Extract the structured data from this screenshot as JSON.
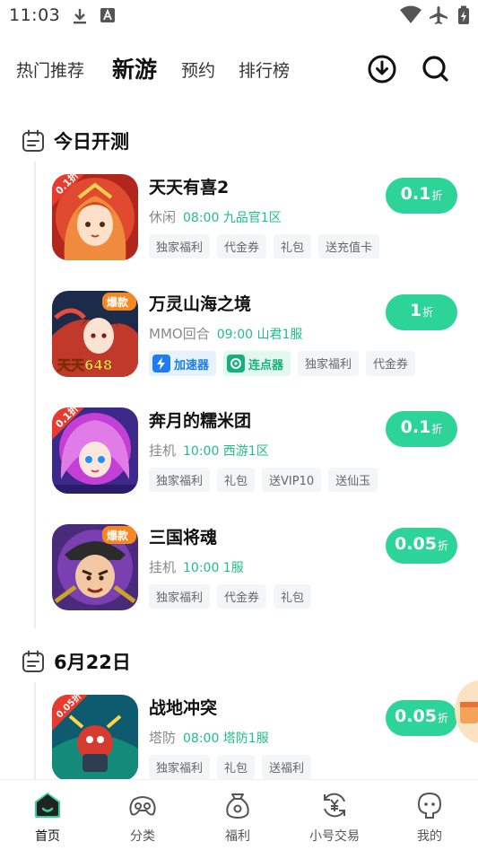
{
  "status_bar": {
    "time": "11:03"
  },
  "top_nav": {
    "tabs": [
      {
        "label": "热门推荐",
        "active": false
      },
      {
        "label": "新游",
        "active": true
      },
      {
        "label": "预约",
        "active": false
      },
      {
        "label": "排行榜",
        "active": false
      }
    ]
  },
  "sections": [
    {
      "title": "今日开测",
      "games": [
        {
          "name": "天天有喜2",
          "category": "休闲",
          "open_time": "08:00 九品官1区",
          "tags": [
            "独家福利",
            "代金券",
            "礼包",
            "送充值卡"
          ],
          "discount": "0.1",
          "discount_unit": "折",
          "badge": "0.1折"
        },
        {
          "name": "万灵山海之境",
          "category": "MMO回合",
          "open_time": "09:00 山君1服",
          "tags": [
            "加速器",
            "连点器",
            "独家福利",
            "代金券"
          ],
          "discount": "1",
          "discount_unit": "折",
          "badge": "爆款",
          "icon_text": "天天648"
        },
        {
          "name": "奔月的糯米团",
          "category": "挂机",
          "open_time": "10:00 西游1区",
          "tags": [
            "独家福利",
            "礼包",
            "送VIP10",
            "送仙玉"
          ],
          "discount": "0.1",
          "discount_unit": "折",
          "badge": "0.1折"
        },
        {
          "name": "三国将魂",
          "category": "挂机",
          "open_time": "10:00 1服",
          "tags": [
            "独家福利",
            "代金券",
            "礼包"
          ],
          "discount": "0.05",
          "discount_unit": "折",
          "badge": "爆款"
        }
      ]
    },
    {
      "title": "6月22日",
      "games": [
        {
          "name": "战地冲突",
          "category": "塔防",
          "open_time": "08:00 塔防1服",
          "tags": [
            "独家福利",
            "礼包",
            "送福利"
          ],
          "discount": "0.05",
          "discount_unit": "折",
          "badge": "0.05折"
        }
      ]
    }
  ],
  "bottom_nav": [
    {
      "label": "首页",
      "icon": "home-icon",
      "active": true
    },
    {
      "label": "分类",
      "icon": "gamepad-icon",
      "active": false
    },
    {
      "label": "福利",
      "icon": "gift-bag-icon",
      "active": false
    },
    {
      "label": "小号交易",
      "icon": "yuan-exchange-icon",
      "active": false
    },
    {
      "label": "我的",
      "icon": "profile-icon",
      "active": false
    }
  ],
  "colors": {
    "accent": "#2dd497",
    "time_text": "#1fbf86",
    "speed_tag": "#1c7cf0"
  }
}
